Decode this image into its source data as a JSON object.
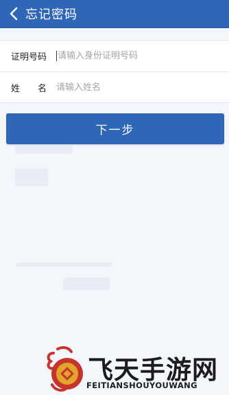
{
  "header": {
    "title": "忘记密码",
    "back_icon": "chevron-left-icon"
  },
  "form": {
    "id_label": "证明号码",
    "id_placeholder": "请输入身份证明号码",
    "name_label_first": "姓",
    "name_label_second": "名",
    "name_placeholder": "请输入姓名"
  },
  "actions": {
    "next_label": "下一步"
  },
  "watermark": {
    "title": "飞天手游网",
    "subtitle": "FEITIANSHOUYOUWANG"
  },
  "colors": {
    "brand": "#2f66b8",
    "background": "#f3f6fa",
    "watermark_red": "#c8342b",
    "watermark_gold": "#e0a52a"
  }
}
